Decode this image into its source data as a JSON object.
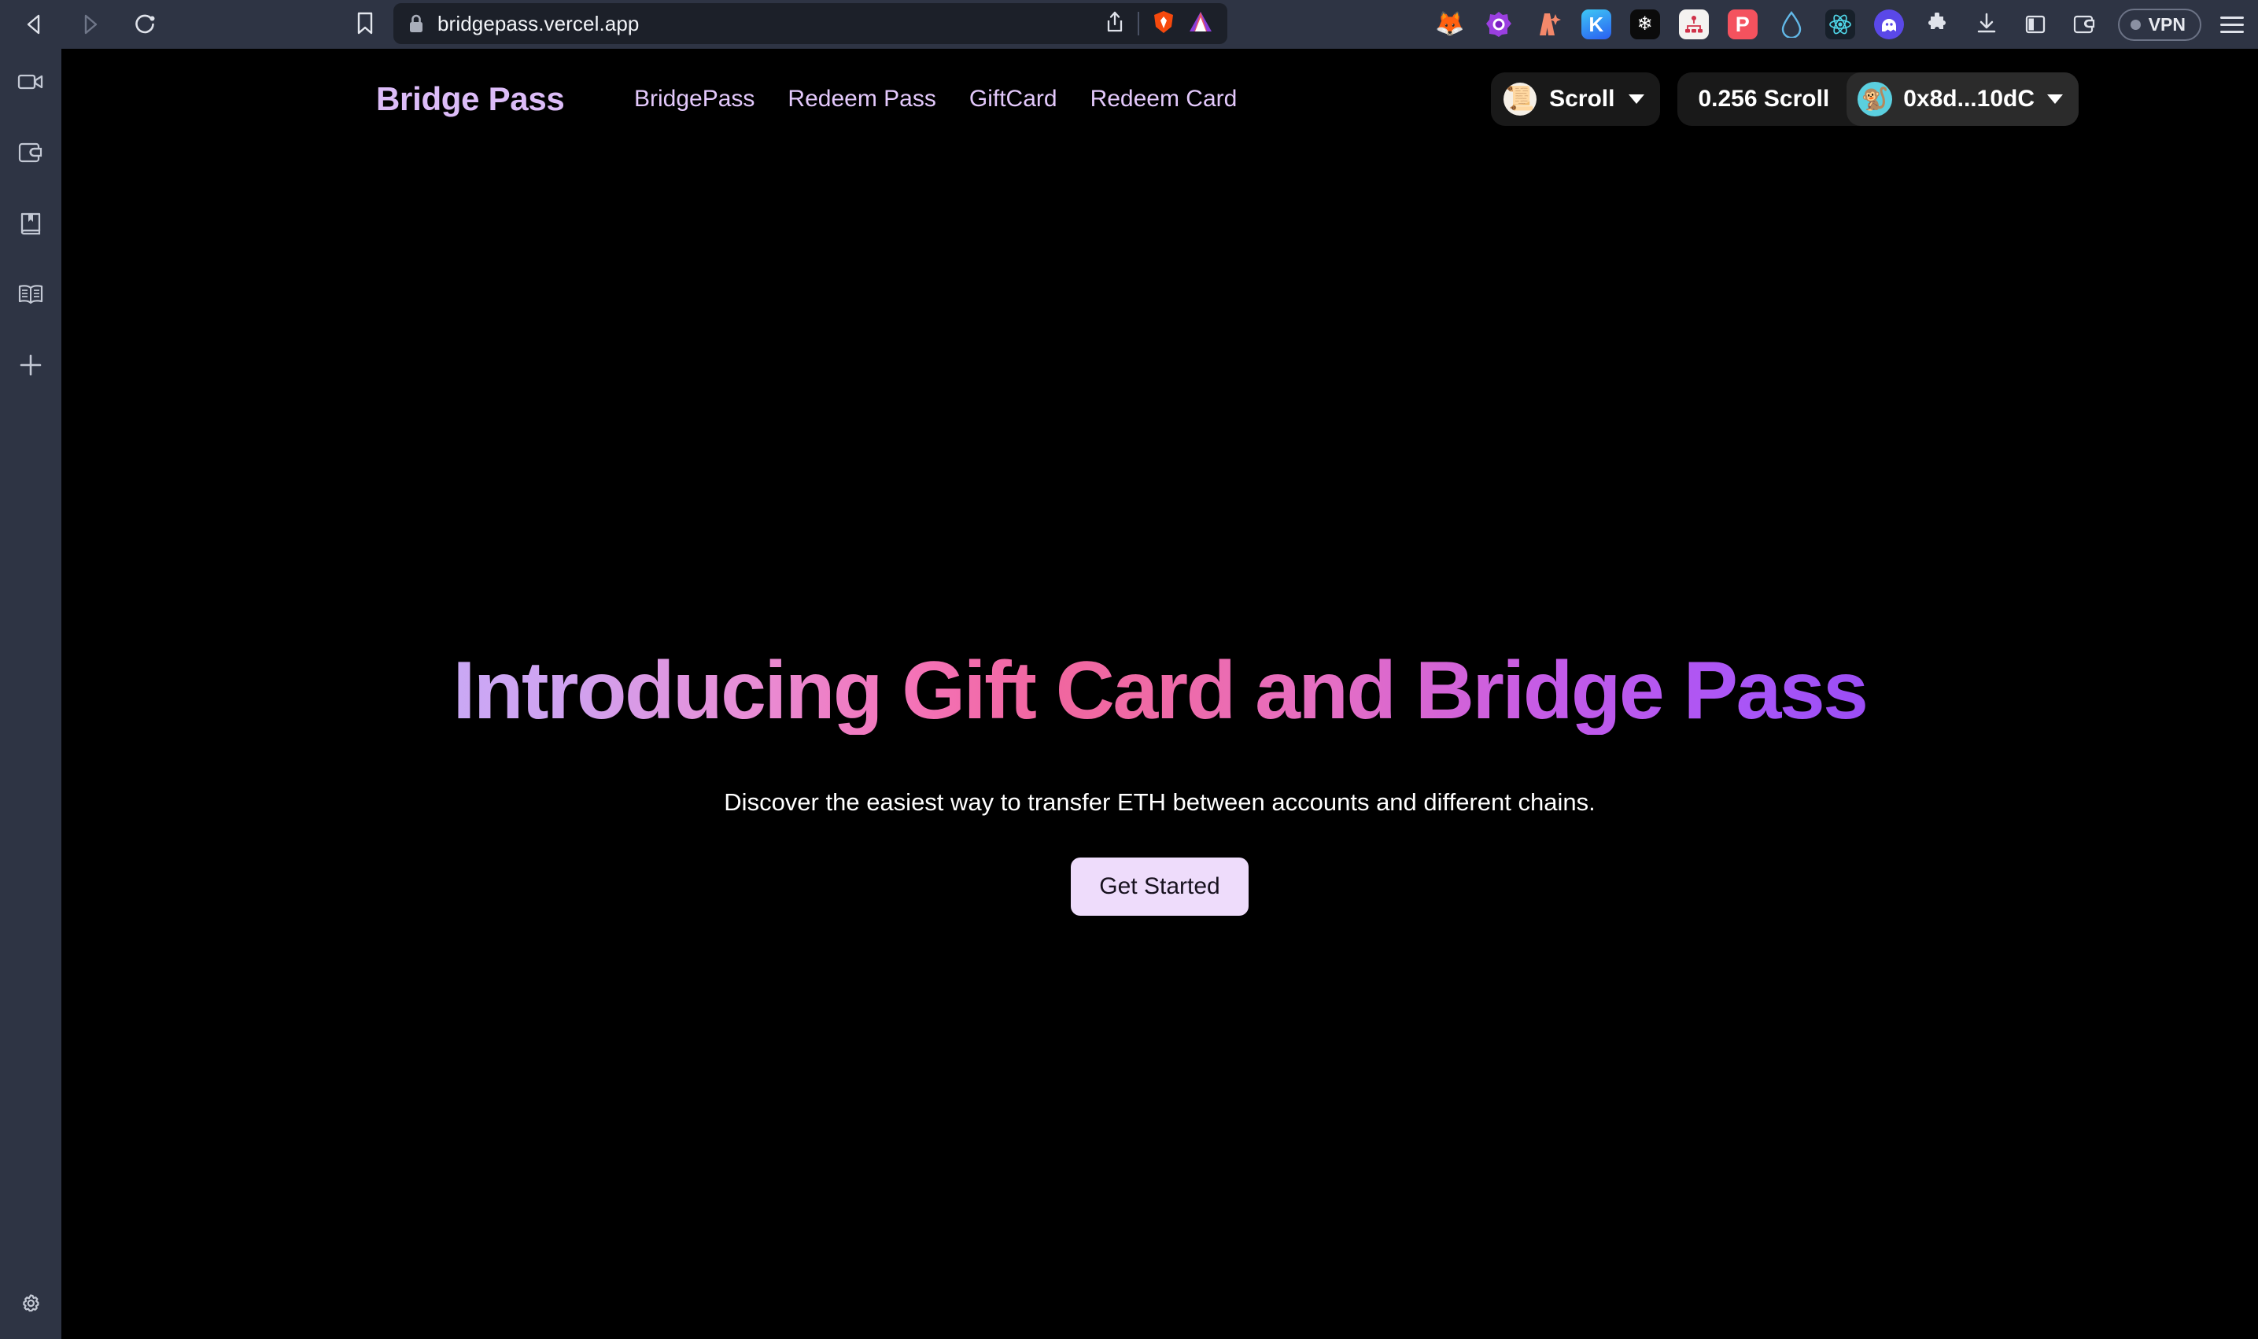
{
  "browser": {
    "back_label": "Back",
    "forward_label": "Forward",
    "reload_label": "Reload",
    "bookmark_label": "Bookmark",
    "url": "bridgepass.vercel.app",
    "share_label": "Share",
    "brave_shields_label": "Brave Shields",
    "brave_rewards_label": "Brave Rewards",
    "vpn_label": "VPN",
    "menu_label": "Menu",
    "extensions": [
      {
        "name": "metamask-extension-icon",
        "glyph": "🦊",
        "bg": "#2e3444"
      },
      {
        "name": "purple-orb-extension-icon",
        "glyph": "🟣",
        "bg": "#2e3444"
      },
      {
        "name": "rainbow-wallet-extension-icon",
        "glyph": "🌊",
        "bg": "#2e3444"
      },
      {
        "name": "keplr-extension-icon",
        "glyph": "K",
        "bg": "#2a8df2"
      },
      {
        "name": "snowflake-extension-icon",
        "glyph": "❄",
        "bg": "#0a0a0a"
      },
      {
        "name": "sitemap-extension-icon",
        "glyph": "⚙",
        "bg": "#f2f2f2"
      },
      {
        "name": "phantom-p-extension-icon",
        "glyph": "P",
        "bg": "#f45a5a"
      },
      {
        "name": "water-drop-extension-icon",
        "glyph": "💧",
        "bg": "#2e3444"
      },
      {
        "name": "react-devtools-extension-icon",
        "glyph": "⚛",
        "bg": "#18202a"
      },
      {
        "name": "phantom-ghost-extension-icon",
        "glyph": "👻",
        "bg": "#5a48e8"
      },
      {
        "name": "puzzle-extensions-icon",
        "glyph": "🧩",
        "bg": "#2e3444"
      },
      {
        "name": "download-icon",
        "glyph": "⤓",
        "bg": "#2e3444"
      },
      {
        "name": "sidebar-toggle-icon",
        "glyph": "◫",
        "bg": "#2e3444"
      },
      {
        "name": "wallet-icon",
        "glyph": "👛",
        "bg": "#2e3444"
      }
    ]
  },
  "sidebar": {
    "items": [
      {
        "name": "video-camera-icon",
        "label": "Video"
      },
      {
        "name": "wallet-icon",
        "label": "Wallet"
      },
      {
        "name": "bookmarked-book-icon",
        "label": "Bookmarks"
      },
      {
        "name": "open-book-icon",
        "label": "Reading List"
      },
      {
        "name": "plus-icon",
        "label": "Add"
      }
    ],
    "settings_label": "Settings"
  },
  "site": {
    "brand": "Bridge Pass",
    "nav": [
      {
        "label": "BridgePass",
        "name": "nav-bridgepass"
      },
      {
        "label": "Redeem Pass",
        "name": "nav-redeem-pass"
      },
      {
        "label": "GiftCard",
        "name": "nav-giftcard"
      },
      {
        "label": "Redeem Card",
        "name": "nav-redeem-card"
      }
    ],
    "wallet": {
      "chain_name": "Scroll",
      "chain_icon": "📜",
      "balance": "0.256 Scroll",
      "address": "0x8d...10dC",
      "avatar_icon": "🐒"
    },
    "hero": {
      "title": "Introducing Gift Card and Bridge Pass",
      "subtitle": "Discover the easiest way to transfer ETH between accounts and different chains.",
      "cta": "Get Started"
    }
  },
  "colors": {
    "brand_purple": "#dcbcf8",
    "nav_link": "#e3c8fb",
    "cta_bg": "#eedcfb",
    "page_bg": "#000000",
    "chrome_bg": "#2e3444"
  }
}
